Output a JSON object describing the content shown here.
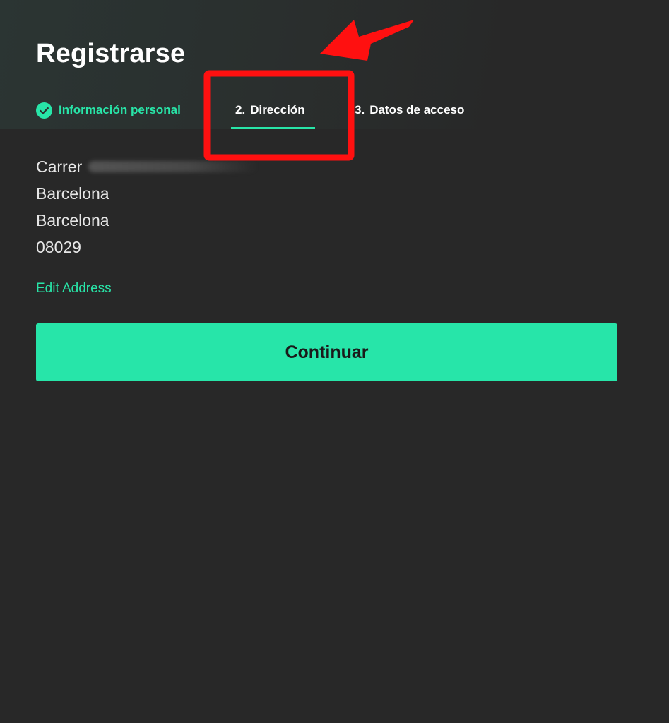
{
  "page": {
    "title": "Registrarse"
  },
  "steps": [
    {
      "number": "",
      "label": "Información personal",
      "state": "completed",
      "icon": "check-circle-icon"
    },
    {
      "number": "2.",
      "label": "Dirección",
      "state": "active"
    },
    {
      "number": "3.",
      "label": "Datos de acceso",
      "state": "upcoming"
    }
  ],
  "address": {
    "street_prefix": "Carrer",
    "city": "Barcelona",
    "province": "Barcelona",
    "postal_code": "08029"
  },
  "actions": {
    "edit_address_label": "Edit Address",
    "continue_label": "Continuar"
  },
  "colors": {
    "background": "#282828",
    "accent": "#27e5a9",
    "annotation": "#ff1010"
  }
}
